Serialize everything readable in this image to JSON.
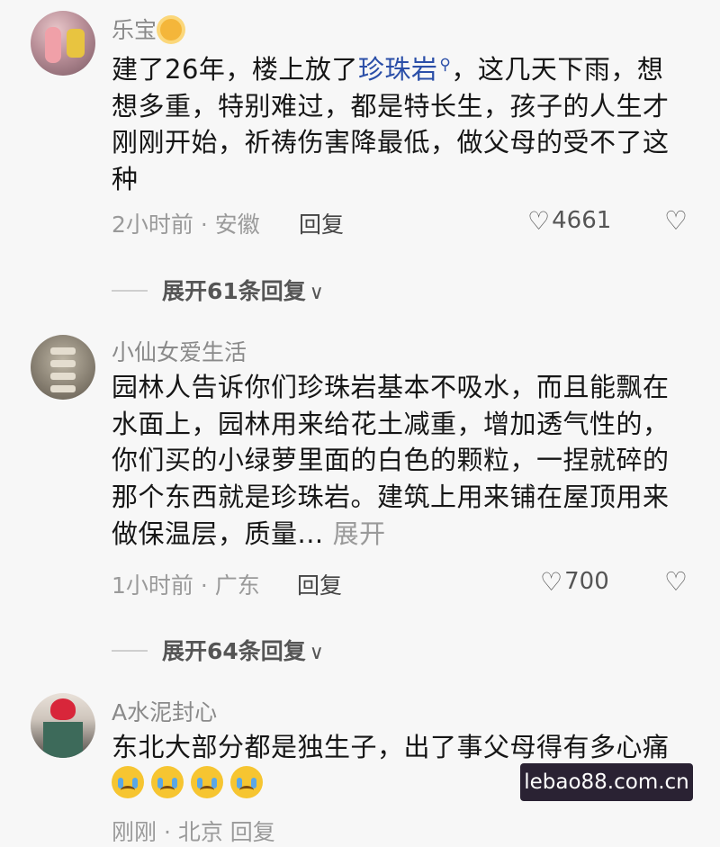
{
  "comments": [
    {
      "username": "乐宝",
      "text_parts": [
        "建了26年，楼上放了",
        "珍珠岩",
        "，这几天下雨，想想多重，特别难过，都是特长生，孩子的人生才刚刚开始，祈祷伤害降最低，做父母的受不了这种"
      ],
      "meta": "2小时前 · 安徽",
      "reply_label": "回复",
      "likes": "4661",
      "expand_label": "展开61条回复"
    },
    {
      "username": "小仙女爱生活",
      "text": "园林人告诉你们珍珠岩基本不吸水，而且能飘在水面上，园林用来给花土减重，增加透气性的，你们买的小绿萝里面的白色的颗粒，一捏就碎的那个东西就是珍珠岩。建筑上用来铺在屋顶用来做保温层，质量...",
      "expand_inline": "展开",
      "meta": "1小时前 · 广东",
      "reply_label": "回复",
      "likes": "700",
      "expand_label": "展开64条回复"
    },
    {
      "username": "A水泥封心",
      "text": "东北大部分都是独生子，出了事父母得有多心痛",
      "emoji_count": 4,
      "meta_partial": "刚刚 · 北京   回复"
    }
  ],
  "watermark": "lebao88.com.cn",
  "icons": {
    "sun": "sun-icon",
    "search": "search-icon",
    "like": "heart-outline-icon",
    "dislike": "broken-heart-icon",
    "expand": "chevron-down-icon",
    "emoji": "crying-face-emoji"
  }
}
